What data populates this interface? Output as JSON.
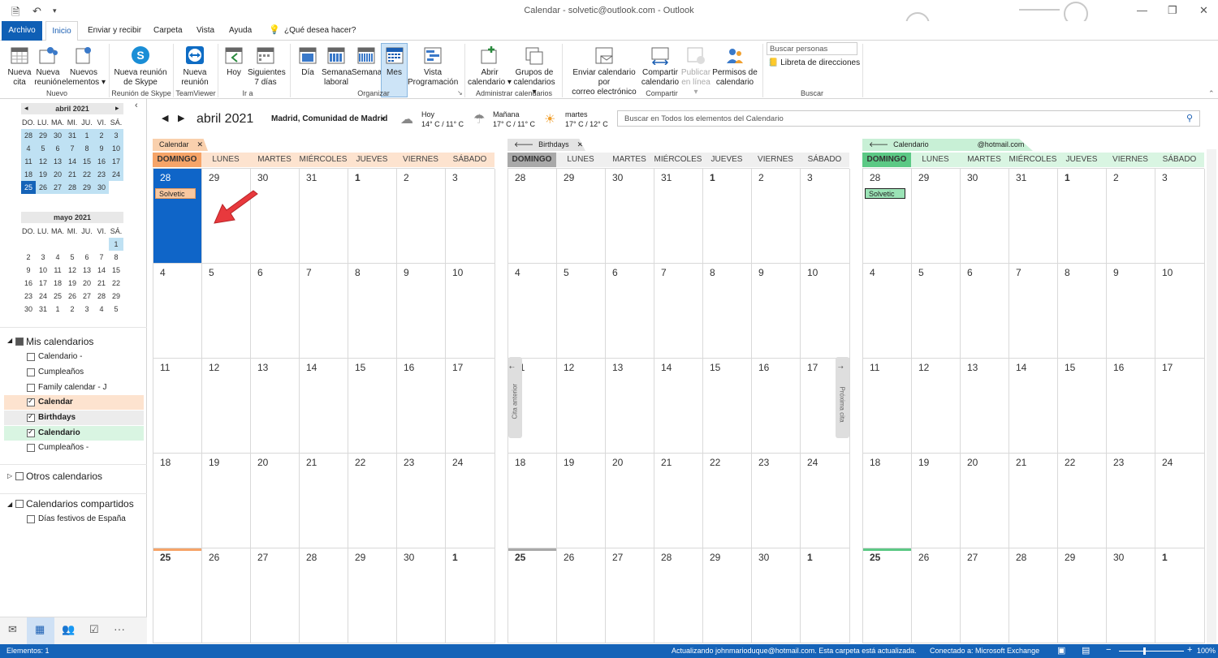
{
  "titlebar": {
    "title": "Calendar - solvetic@outlook.com  -  Outlook",
    "save_icon": "save-icon",
    "undo_icon": "undo-icon"
  },
  "menu": {
    "file": "Archivo",
    "tabs": [
      "Inicio",
      "Enviar y recibir",
      "Carpeta",
      "Vista",
      "Ayuda"
    ],
    "tellme": "¿Qué desea hacer?"
  },
  "ribbon": {
    "nueva_cita": [
      "Nueva",
      "cita"
    ],
    "nueva_reunion": [
      "Nueva",
      "reunión"
    ],
    "nuevos_elementos": [
      "Nuevos",
      "elementos ▾"
    ],
    "skype": [
      "Nueva reunión",
      "de Skype"
    ],
    "teamviewer": [
      "Nueva",
      "reunión"
    ],
    "hoy": [
      "Hoy",
      ""
    ],
    "siguientes": [
      "Siguientes",
      "7 días"
    ],
    "dia": [
      "Día",
      ""
    ],
    "semana_laboral": [
      "Semana",
      "laboral"
    ],
    "semana": [
      "Semana",
      ""
    ],
    "mes": [
      "Mes",
      ""
    ],
    "vista_prog": [
      "Vista",
      "Programación"
    ],
    "abrir": [
      "Abrir",
      "calendario ▾"
    ],
    "grupos": [
      "Grupos de",
      "calendarios ▾"
    ],
    "enviar": [
      "Enviar calendario por",
      "correo electrónico"
    ],
    "compartir": [
      "Compartir",
      "calendario"
    ],
    "publicar": [
      "Publicar",
      "en línea ▾"
    ],
    "permisos": [
      "Permisos de",
      "calendario"
    ],
    "buscar_personas": "Buscar personas",
    "libreta": "Libreta de direcciones",
    "groups": [
      "Nuevo",
      "Reunión de Skype",
      "TeamViewer",
      "Ir a",
      "Organizar",
      "Administrar calendarios",
      "Compartir",
      "Buscar"
    ]
  },
  "mini_april": {
    "title": "abril 2021",
    "days": [
      "DO.",
      "LU.",
      "MA.",
      "MI.",
      "JU.",
      "VI.",
      "SÁ."
    ],
    "weeks": [
      [
        "28",
        "29",
        "30",
        "31",
        "1",
        "2",
        "3"
      ],
      [
        "4",
        "5",
        "6",
        "7",
        "8",
        "9",
        "10"
      ],
      [
        "11",
        "12",
        "13",
        "14",
        "15",
        "16",
        "17"
      ],
      [
        "18",
        "19",
        "20",
        "21",
        "22",
        "23",
        "24"
      ],
      [
        "25",
        "26",
        "27",
        "28",
        "29",
        "30",
        ""
      ]
    ]
  },
  "mini_may": {
    "title": "mayo 2021",
    "days": [
      "DO.",
      "LU.",
      "MA.",
      "MI.",
      "JU.",
      "VI.",
      "SÁ."
    ],
    "weeks": [
      [
        "",
        "",
        "",
        "",
        "",
        "",
        "1"
      ],
      [
        "2",
        "3",
        "4",
        "5",
        "6",
        "7",
        "8"
      ],
      [
        "9",
        "10",
        "11",
        "12",
        "13",
        "14",
        "15"
      ],
      [
        "16",
        "17",
        "18",
        "19",
        "20",
        "21",
        "22"
      ],
      [
        "23",
        "24",
        "25",
        "26",
        "27",
        "28",
        "29"
      ],
      [
        "30",
        "31",
        "1",
        "2",
        "3",
        "4",
        "5"
      ]
    ]
  },
  "folders": {
    "mis": "Mis calendarios",
    "items": [
      "Calendario -",
      "Cumpleaños",
      "Family calendar - J",
      "Calendar",
      "Birthdays",
      "Calendario",
      "Cumpleaños -"
    ],
    "otros": "Otros calendarios",
    "compartidos": "Calendarios compartidos",
    "festivos": "Días festivos de España"
  },
  "header": {
    "month": "abril 2021",
    "location": "Madrid, Comunidad de Madrid",
    "weather": [
      {
        "day": "Hoy",
        "temp": "14° C / 11° C"
      },
      {
        "day": "Mañana",
        "temp": "17° C / 11° C"
      },
      {
        "day": "martes",
        "temp": "17° C / 12° C"
      }
    ],
    "search": "Buscar en Todos los elementos del Calendario"
  },
  "panes": [
    {
      "tab": "Calendar",
      "color": "#f9d0ad",
      "hdr": "#fde3cf",
      "accent": "#f6a468",
      "event": "Solvetic"
    },
    {
      "tab": "Birthdays",
      "color": "#e3e3e3",
      "hdr": "#efefef",
      "accent": "#a9a9a9",
      "event": ""
    },
    {
      "tab": "Calendario",
      "tab2": "@hotmail.com",
      "color": "#c8f0d6",
      "hdr": "#d9f5e2",
      "accent": "#5cc985",
      "event": "Solvetic"
    }
  ],
  "weekdays": [
    "DOMINGO",
    "LUNES",
    "MARTES",
    "MIÉRCOLES",
    "JUEVES",
    "VIERNES",
    "SÁBADO"
  ],
  "month_grid": [
    [
      "28",
      "29",
      "30",
      "31",
      "1",
      "2",
      "3"
    ],
    [
      "4",
      "5",
      "6",
      "7",
      "8",
      "9",
      "10"
    ],
    [
      "11",
      "12",
      "13",
      "14",
      "15",
      "16",
      "17"
    ],
    [
      "18",
      "19",
      "20",
      "21",
      "22",
      "23",
      "24"
    ],
    [
      "25",
      "26",
      "27",
      "28",
      "29",
      "30",
      "1"
    ]
  ],
  "nav": {
    "prev": "Cita anterior",
    "next": "Próxima cita"
  },
  "status": {
    "items": "Elementos: 1",
    "updating": "Actualizando johnmarioduque@hotmail.com.  Esta carpeta está actualizada.",
    "connected": "Conectado a: Microsoft Exchange",
    "zoom": "100%"
  }
}
